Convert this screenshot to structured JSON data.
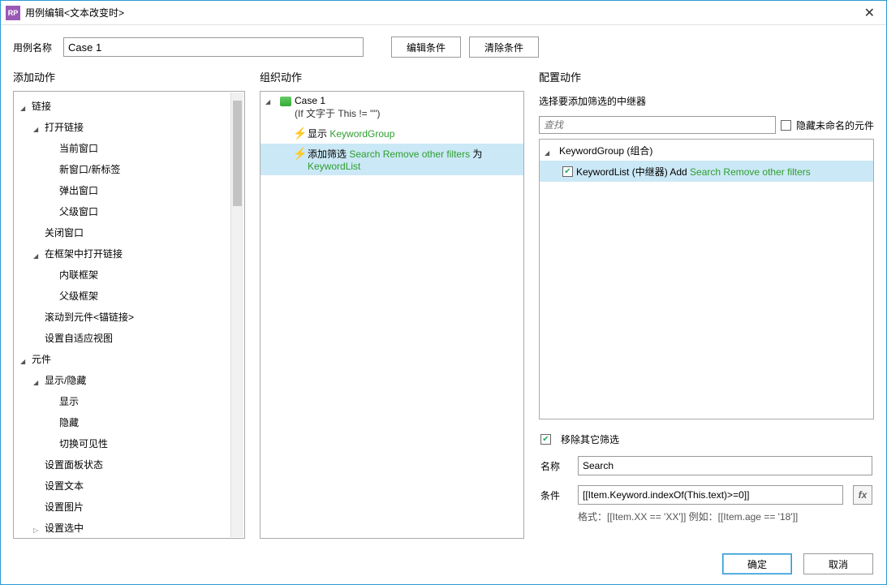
{
  "title": "用例编辑<文本改变时>",
  "appIconText": "RP",
  "topRow": {
    "nameLabel": "用例名称",
    "nameValue": "Case 1",
    "editBtn": "编辑条件",
    "clearBtn": "清除条件"
  },
  "headers": {
    "addAction": "添加动作",
    "orgAction": "组织动作",
    "cfgAction": "配置动作"
  },
  "actionTree": [
    {
      "level": 0,
      "arrow": "open",
      "label": "链接"
    },
    {
      "level": 1,
      "arrow": "open",
      "label": "打开链接"
    },
    {
      "level": 2,
      "arrow": "",
      "label": "当前窗口"
    },
    {
      "level": 2,
      "arrow": "",
      "label": "新窗口/新标签"
    },
    {
      "level": 2,
      "arrow": "",
      "label": "弹出窗口"
    },
    {
      "level": 2,
      "arrow": "",
      "label": "父级窗口"
    },
    {
      "level": 1,
      "arrow": "",
      "label": "关闭窗口"
    },
    {
      "level": 1,
      "arrow": "open",
      "label": "在框架中打开链接"
    },
    {
      "level": 2,
      "arrow": "",
      "label": "内联框架"
    },
    {
      "level": 2,
      "arrow": "",
      "label": "父级框架"
    },
    {
      "level": 1,
      "arrow": "",
      "label": "滚动到元件<锚链接>"
    },
    {
      "level": 1,
      "arrow": "",
      "label": "设置自适应视图"
    },
    {
      "level": 0,
      "arrow": "open",
      "label": "元件"
    },
    {
      "level": 1,
      "arrow": "open",
      "label": "显示/隐藏"
    },
    {
      "level": 2,
      "arrow": "",
      "label": "显示"
    },
    {
      "level": 2,
      "arrow": "",
      "label": "隐藏"
    },
    {
      "level": 2,
      "arrow": "",
      "label": "切换可见性"
    },
    {
      "level": 1,
      "arrow": "",
      "label": "设置面板状态"
    },
    {
      "level": 1,
      "arrow": "",
      "label": "设置文本"
    },
    {
      "level": 1,
      "arrow": "",
      "label": "设置图片"
    },
    {
      "level": 1,
      "arrow": "closed",
      "label": "设置选中"
    }
  ],
  "org": {
    "caseName": "Case 1",
    "condition": "(If 文字于 This != \"\")",
    "action1Prefix": "显示 ",
    "action1Green": "KeywordGroup",
    "action2Prefix": "添加筛选 ",
    "action2Green1": "Search Remove other filters",
    "action2Mid": " 为 ",
    "action2Green2": "KeywordList"
  },
  "cfg": {
    "selectLabel": "选择要添加筛选的中继器",
    "searchPlaceholder": "查找",
    "hideUnnamed": "隐藏未命名的元件",
    "groupLabel": "KeywordGroup (组合)",
    "itemLabel": "KeywordList (中继器) Add ",
    "itemGreen": "Search Remove other filters",
    "removeOther": "移除其它筛选",
    "nameLabel": "名称",
    "nameValue": "Search",
    "condLabel": "条件",
    "condValue": "[[Item.Keyword.indexOf(This.text)>=0]]",
    "hint": "格式：[[Item.XX == 'XX']] 例如：[[Item.age == '18']]"
  },
  "footer": {
    "ok": "确定",
    "cancel": "取消"
  }
}
